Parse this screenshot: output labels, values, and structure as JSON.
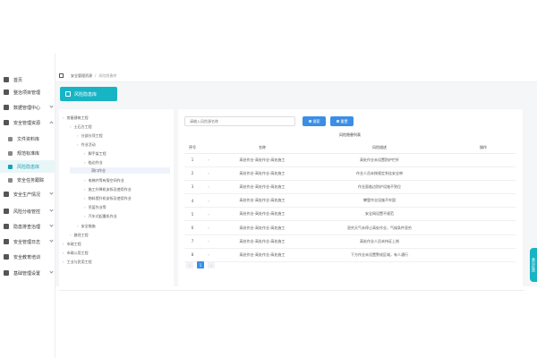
{
  "sidebar": {
    "items": [
      {
        "label": "首页",
        "icon": "home-icon"
      },
      {
        "label": "整治项目管理",
        "icon": "folder-icon"
      },
      {
        "label": "数据管理中心",
        "icon": "database-icon"
      },
      {
        "label": "安全管理资源",
        "icon": "shield-icon"
      },
      {
        "label": "文件资料库",
        "icon": "file-icon"
      },
      {
        "label": "规范标准库",
        "icon": "book-icon"
      },
      {
        "label": "风险隐患库",
        "icon": "warning-icon"
      },
      {
        "label": "安全任务跟踪",
        "icon": "task-icon"
      },
      {
        "label": "安全生产情况",
        "icon": "chart-icon"
      },
      {
        "label": "风险分级管控",
        "icon": "layers-icon"
      },
      {
        "label": "隐患排查治理",
        "icon": "search-icon"
      },
      {
        "label": "安全管理日志",
        "icon": "log-icon"
      },
      {
        "label": "安全教育培训",
        "icon": "education-icon"
      },
      {
        "label": "基础管理设置",
        "icon": "gear-icon"
      }
    ]
  },
  "breadcrumb": {
    "level1": "安全管理资源",
    "separator": "/",
    "level2": "风险隐患库"
  },
  "page_head": {
    "title": "风险隐患库"
  },
  "tree": {
    "nodes": [
      "房屋建筑工程",
      "土石方工程",
      "分部分项工程",
      "作业活动",
      "脚手架工程",
      "临边作业",
      "洞口作业",
      "电梯井等有限空间作业",
      "施工升降机安拆及使用作业",
      "物料提升机安拆及使用作业",
      "吊篮作业等",
      "汽车式起重机作业",
      "安全措施",
      "路径工程",
      "市政工程",
      "市政公用工程",
      "工业与民用工程"
    ]
  },
  "search": {
    "placeholder": "请输入风险源名称",
    "search_label": "搜索",
    "reset_label": "重置"
  },
  "table": {
    "title": "风险隐患列表",
    "headers": [
      "序号",
      "名称",
      "风险描述",
      "操作"
    ],
    "rows": [
      {
        "no": "1",
        "expand": "›",
        "name": "高处作业-高处作业-高处施工",
        "desc": "高处作业未设置防护栏杆"
      },
      {
        "no": "2",
        "expand": "›",
        "name": "高处作业-高处作业-高处施工",
        "desc": "作业人员未按规定系挂安全带"
      },
      {
        "no": "3",
        "expand": "›",
        "name": "高处作业-高处作业-高处施工",
        "desc": "作业面临边防护设施不到位"
      },
      {
        "no": "4",
        "expand": "›",
        "name": "高处作业-高处作业-高处施工",
        "desc": "攀登作业设施不牢固"
      },
      {
        "no": "5",
        "expand": "›",
        "name": "高处作业-高处作业-高处施工",
        "desc": "安全网设置不规范"
      },
      {
        "no": "6",
        "expand": "›",
        "name": "高处作业-高处作业-高处施工",
        "desc": "恶劣天气未停止高处作业，气候条件恶劣"
      },
      {
        "no": "7",
        "expand": "›",
        "name": "高处作业-高处作业-高处施工",
        "desc": "高处作业人员未持证上岗"
      },
      {
        "no": "8",
        "expand": "›",
        "name": "高处作业-高处作业-高处施工",
        "desc": "下方作业未设置警戒区域，有人通行"
      }
    ]
  },
  "pagination": {
    "prev": "‹",
    "current": "1",
    "next": "›"
  },
  "float_widget": {
    "label": "意见反馈"
  },
  "colors": {
    "accent": "#17b4c4",
    "primary": "#3b8ee6"
  }
}
